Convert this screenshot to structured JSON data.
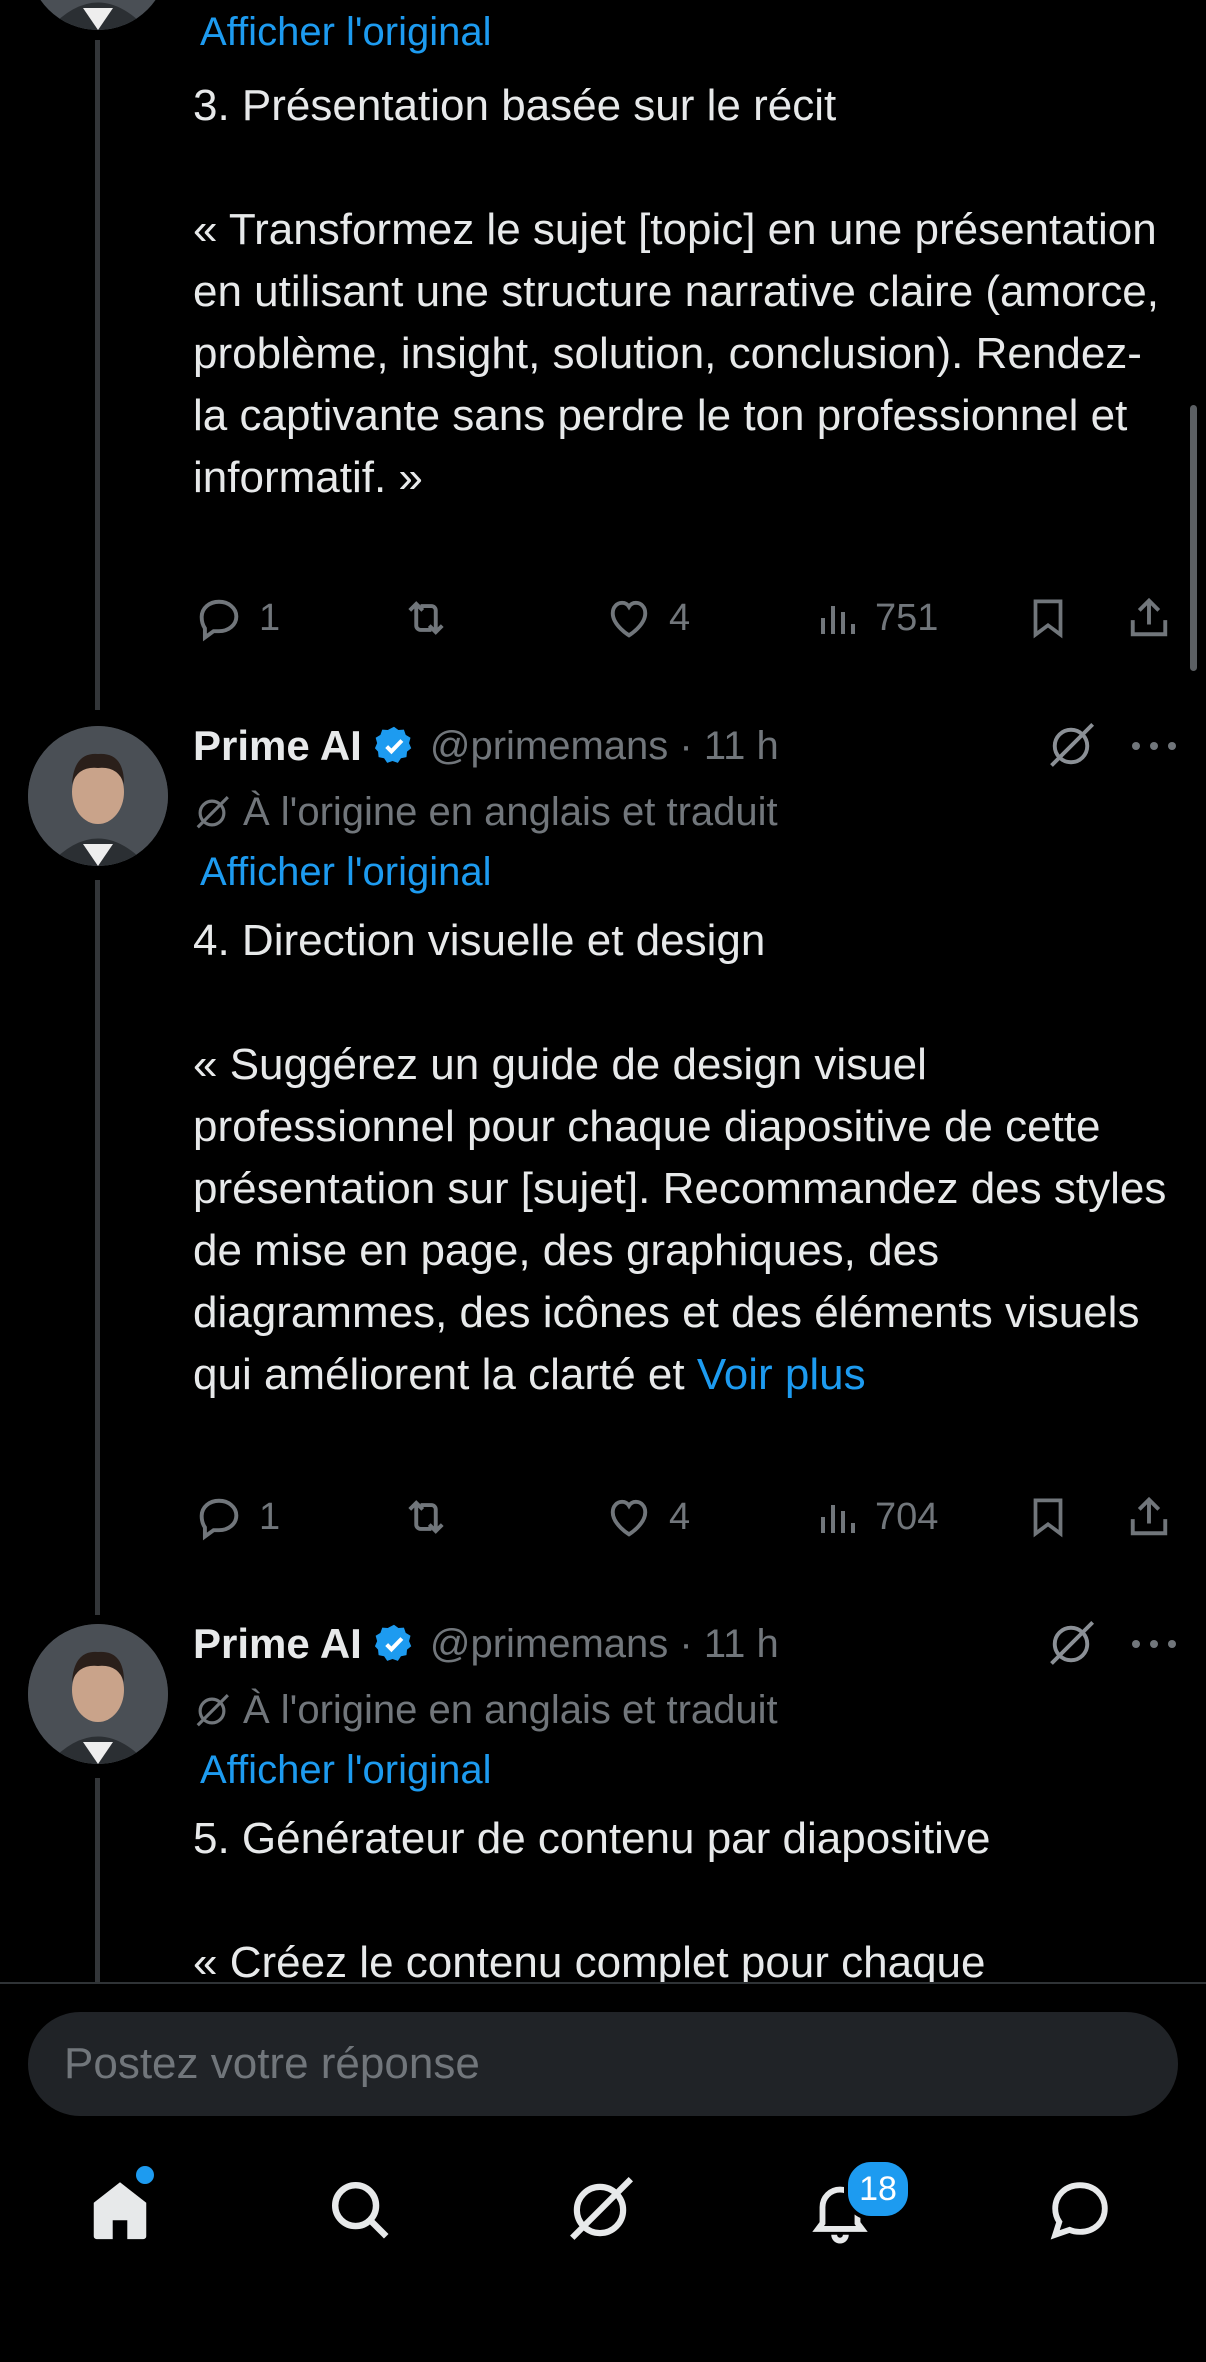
{
  "tweets": [
    {
      "show_original": "Afficher l'original",
      "title": "3. Présentation basée sur le récit",
      "body": "« Transformez le sujet [topic] en une présentation en utilisant une structure narrative claire (amorce, problème, insight, solution, conclusion). Rendez-la captivante sans perdre le ton professionnel et informatif. »",
      "replies": "1",
      "likes": "4",
      "views": "751"
    },
    {
      "author": "Prime AI",
      "handle": "@primemans · 11 h",
      "translated_note": "À l'origine en anglais et traduit",
      "show_original": "Afficher l'original",
      "title": "4. Direction visuelle et design",
      "body": "« Suggérez un guide de design visuel professionnel pour chaque diapositive de cette présentation sur [sujet]. Recommandez des styles de mise en page, des graphiques, des diagrammes, des icônes et des éléments visuels qui améliorent la clarté et",
      "see_more": "Voir plus",
      "replies": "1",
      "likes": "4",
      "views": "704"
    },
    {
      "author": "Prime AI",
      "handle": "@primemans · 11 h",
      "translated_note": "À l'origine en anglais et traduit",
      "show_original": "Afficher l'original",
      "title": "5. Générateur de contenu par diapositive",
      "body": "« Créez le contenu complet pour chaque"
    }
  ],
  "reply_placeholder": "Postez votre réponse",
  "nav": {
    "notifications_badge": "18"
  },
  "colors": {
    "background": "#000000",
    "text": "#e7e9ea",
    "muted": "#71767b",
    "accent": "#1d9bf0"
  },
  "icons": {
    "reply": "reply-icon",
    "retweet": "retweet-icon",
    "like": "heart-icon",
    "views": "views-icon",
    "bookmark": "bookmark-icon",
    "share": "share-icon",
    "grok": "grok-icon",
    "more": "more-icon",
    "home": "home-icon",
    "search": "search-icon",
    "notifications": "bell-icon",
    "messages": "chat-icon"
  }
}
